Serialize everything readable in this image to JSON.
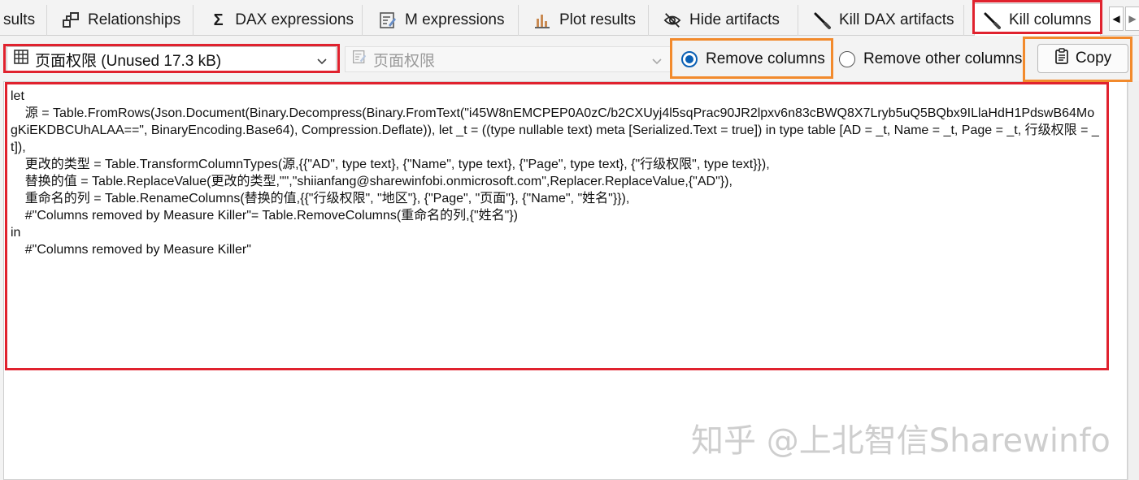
{
  "tabs": [
    {
      "label": "sults",
      "icon": "none"
    },
    {
      "label": "Relationships",
      "icon": "relationships-icon"
    },
    {
      "label": "DAX expressions",
      "icon": "sigma-icon"
    },
    {
      "label": "M expressions",
      "icon": "m-expression-icon"
    },
    {
      "label": "Plot results",
      "icon": "bar-chart-icon"
    },
    {
      "label": "Hide artifacts",
      "icon": "eye-slash-icon"
    },
    {
      "label": "Kill DAX artifacts",
      "icon": "knife-icon"
    },
    {
      "label": "Kill columns",
      "icon": "knife-icon",
      "active": true
    }
  ],
  "toolbar": {
    "table_select": "页面权限 (Unused 17.3 kB)",
    "secondary_select": "页面权限",
    "radio_remove": "Remove columns",
    "radio_remove_other": "Remove other columns",
    "selected_radio": "Remove columns",
    "copy_label": "Copy"
  },
  "editor": {
    "lines": [
      "let",
      "    源 = Table.FromRows(Json.Document(Binary.Decompress(Binary.FromText(\"i45W8nEMCPEP0A0zC/b2CXUyj4l5sqPrac90JR2lpxv6n83cBWQ8X7Lryb5uQ5BQbx9ILlaHdH1PdswB64MogKiEKDBCUhALAA==\", BinaryEncoding.Base64), Compression.Deflate)), let _t = ((type nullable text) meta [Serialized.Text = true]) in type table [AD = _t, Name = _t, Page = _t, 行级权限 = _t]),",
      "    更改的类型 = Table.TransformColumnTypes(源,{{\"AD\", type text}, {\"Name\", type text}, {\"Page\", type text}, {\"行级权限\", type text}}),",
      "    替换的值 = Table.ReplaceValue(更改的类型,\"\",\"shiianfang@sharewinfobi.onmicrosoft.com\",Replacer.ReplaceValue,{\"AD\"}),",
      "    重命名的列 = Table.RenameColumns(替换的值,{{\"行级权限\", \"地区\"}, {\"Page\", \"页面\"}, {\"Name\", \"姓名\"}}),",
      "    #\"Columns removed by Measure Killer\"= Table.RemoveColumns(重命名的列,{\"姓名\"})",
      "in",
      "    #\"Columns removed by Measure Killer\""
    ]
  },
  "watermark": "知乎 @上北智信Sharewinfo",
  "colors": {
    "highlight_red": "#e0222e",
    "highlight_orange": "#f28a2c",
    "radio_accent": "#0a5fb4"
  }
}
